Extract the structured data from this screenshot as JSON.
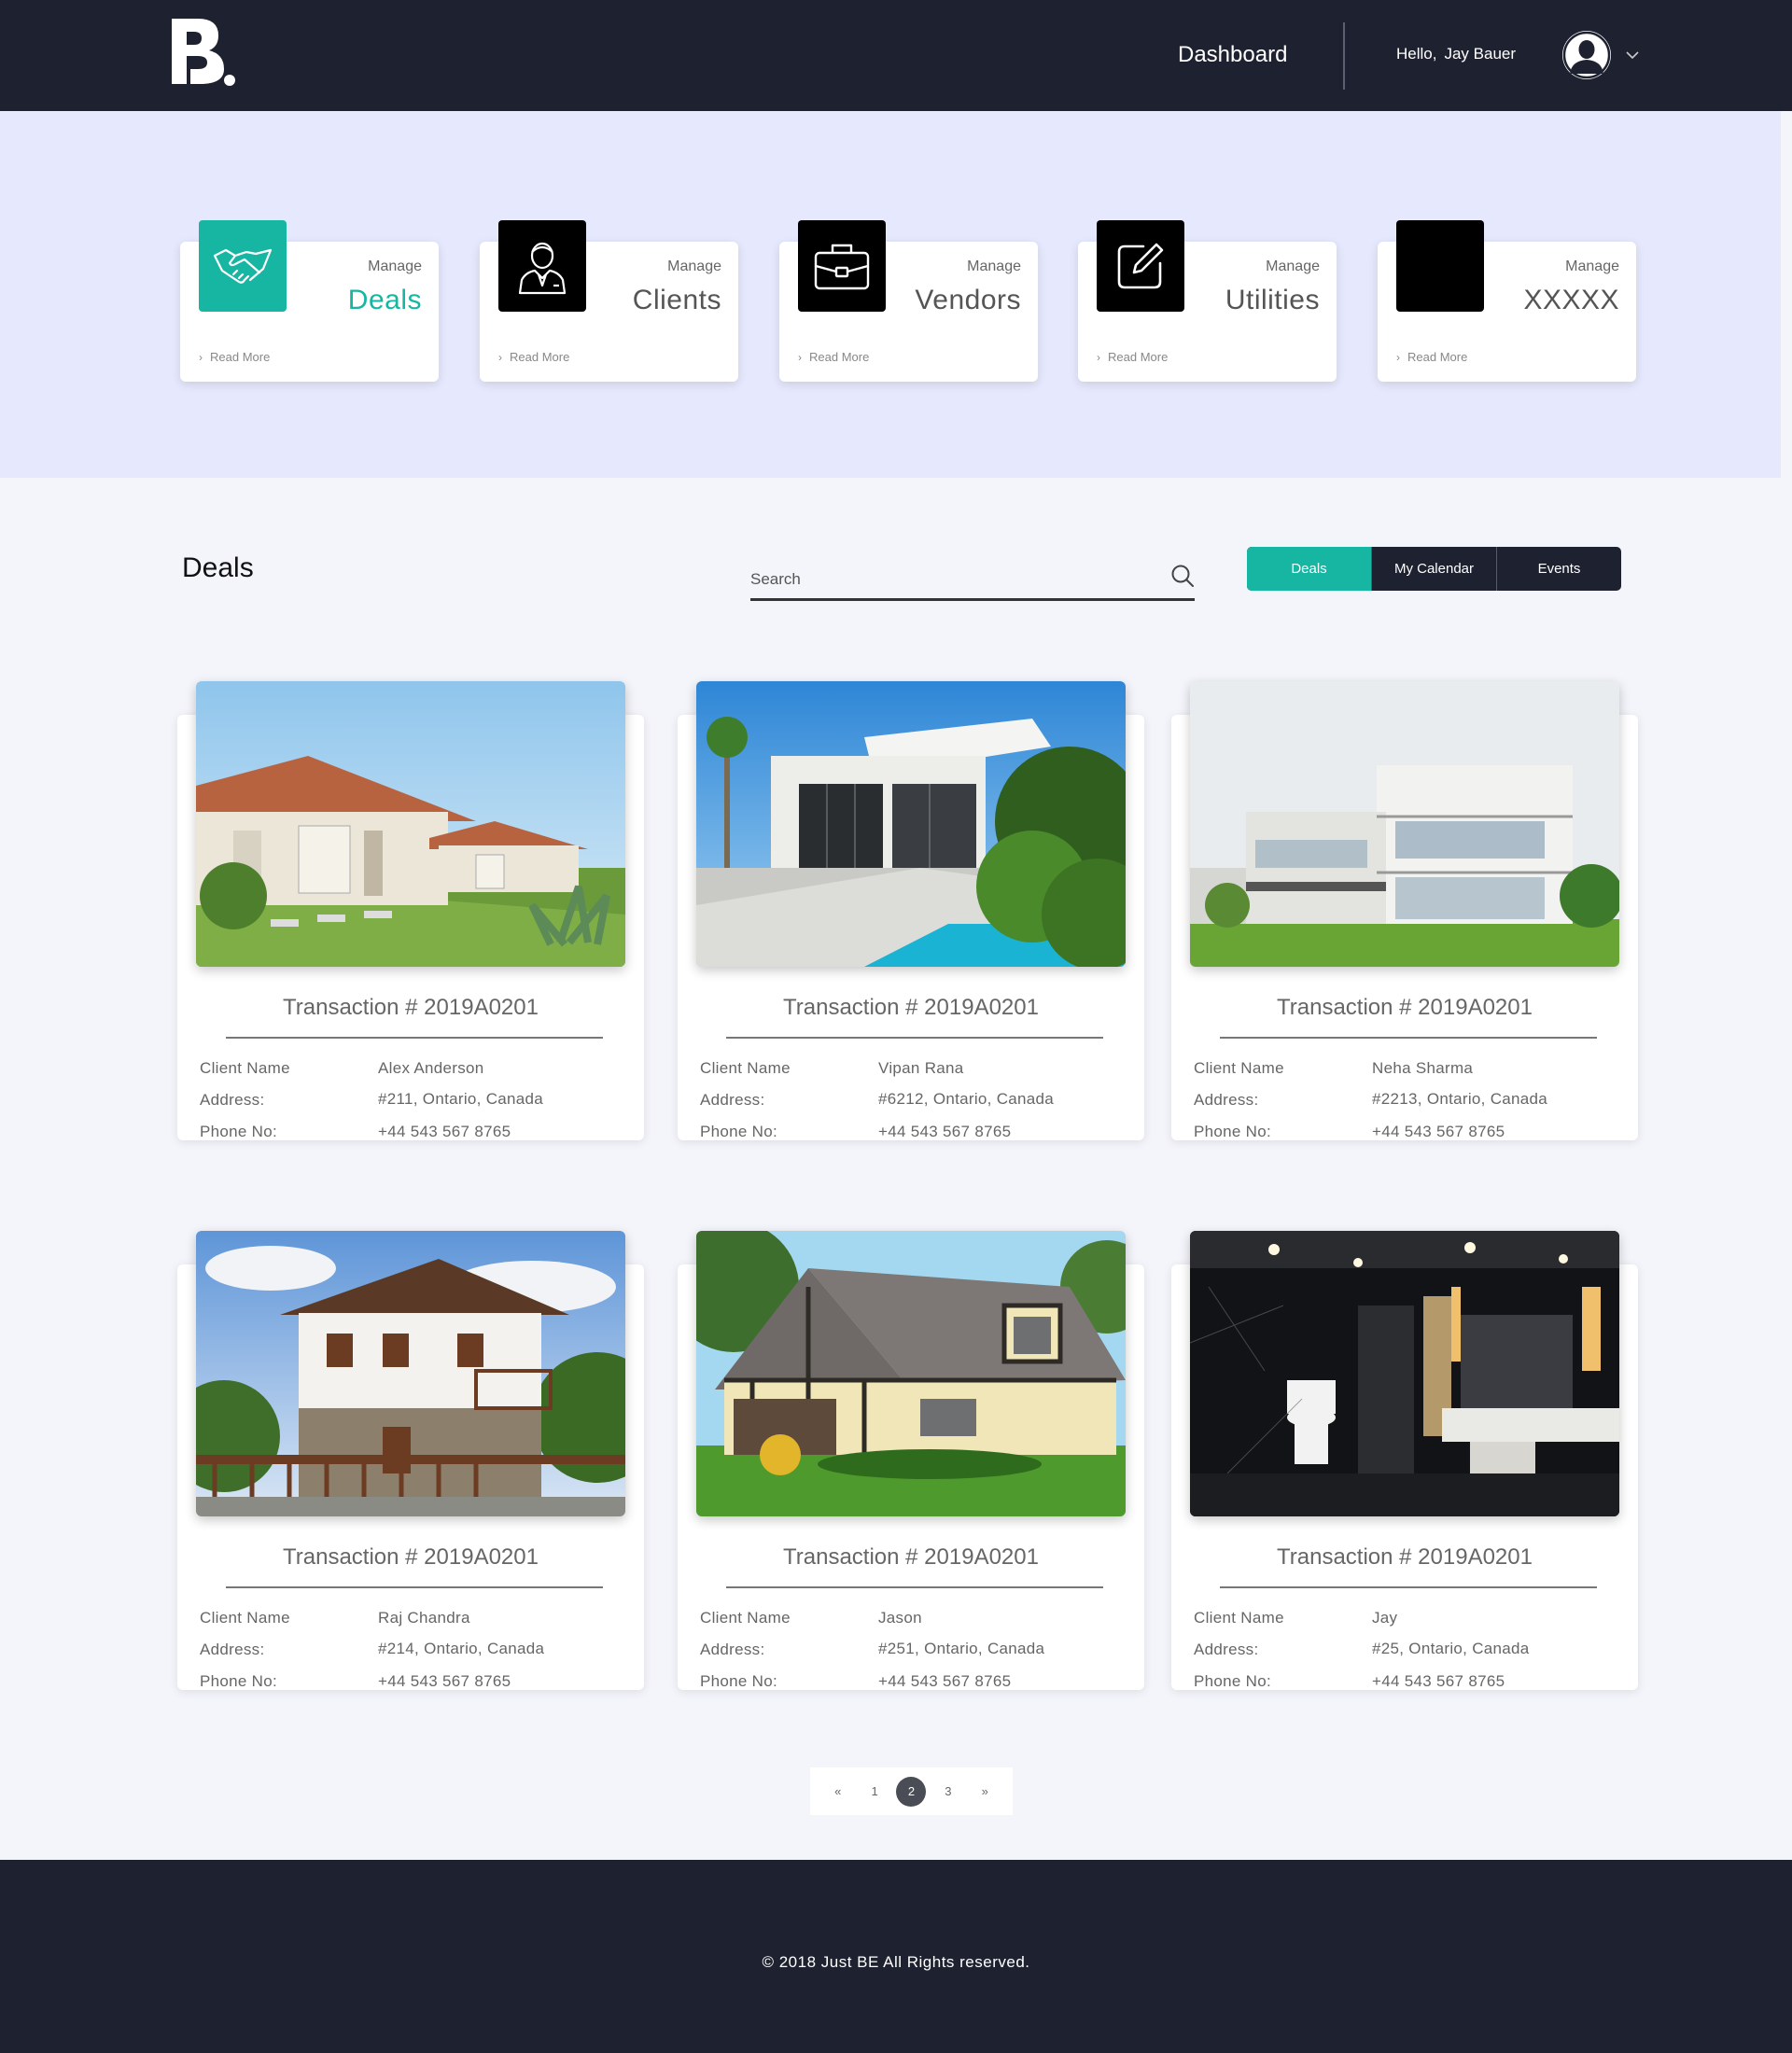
{
  "header": {
    "nav_label": "Dashboard",
    "greeting": "Hello,",
    "user_name": "Jay Bauer",
    "icons": [
      "be-logo",
      "user-avatar-icon",
      "chevron-down-icon"
    ]
  },
  "manage_cards": [
    {
      "prefix": "Manage",
      "title": "Deals",
      "link": "Read More",
      "icon": "handshake-icon",
      "active": true
    },
    {
      "prefix": "Manage",
      "title": "Clients",
      "link": "Read More",
      "icon": "client-icon",
      "active": false
    },
    {
      "prefix": "Manage",
      "title": "Vendors",
      "link": "Read More",
      "icon": "briefcase-icon",
      "active": false
    },
    {
      "prefix": "Manage",
      "title": "Utilities",
      "link": "Read More",
      "icon": "edit-icon",
      "active": false
    },
    {
      "prefix": "Manage",
      "title": "XXXXX",
      "link": "Read More",
      "icon": "blank-icon",
      "active": false
    }
  ],
  "section": {
    "title": "Deals",
    "search_placeholder": "Search",
    "tabs": [
      {
        "label": "Deals",
        "active": true
      },
      {
        "label": "My Calendar",
        "active": false
      },
      {
        "label": "Events",
        "active": false
      }
    ]
  },
  "field_labels": {
    "client": "Client Name",
    "address": "Address:",
    "phone": "Phone No:"
  },
  "deals": [
    {
      "title": "Transaction # 2019A0201",
      "client": "Alex Anderson",
      "address": "#211, Ontario, Canada",
      "phone": "+44 543 567 8765",
      "photo": "villa-photo"
    },
    {
      "title": "Transaction # 2019A0201",
      "client": "Vipan Rana",
      "address": "#6212, Ontario, Canada",
      "phone": "+44 543 567 8765",
      "photo": "modern-house-pool-photo"
    },
    {
      "title": "Transaction # 2019A0201",
      "client": "Neha Sharma",
      "address": "#2213, Ontario, Canada",
      "phone": "+44 543 567 8765",
      "photo": "apartment-building-photo"
    },
    {
      "title": "Transaction # 2019A0201",
      "client": "Raj Chandra",
      "address": "#214, Ontario, Canada",
      "phone": "+44 543 567 8765",
      "photo": "stone-house-photo"
    },
    {
      "title": "Transaction # 2019A0201",
      "client": "Jason",
      "address": "#251, Ontario, Canada",
      "phone": "+44 543 567 8765",
      "photo": "tudor-house-photo"
    },
    {
      "title": "Transaction # 2019A0201",
      "client": "Jay",
      "address": "#25, Ontario, Canada",
      "phone": "+44 543 567 8765",
      "photo": "bathroom-interior-photo"
    }
  ],
  "pagination": {
    "prev": "«",
    "pages": [
      "1",
      "2",
      "3"
    ],
    "current": "2",
    "next": "»"
  },
  "footer": {
    "copyright": "© 2018 Just BE All Rights reserved."
  },
  "colors": {
    "accent": "#17b6a3",
    "navy": "#1e2130",
    "hero_bg": "#e6e8fd"
  }
}
